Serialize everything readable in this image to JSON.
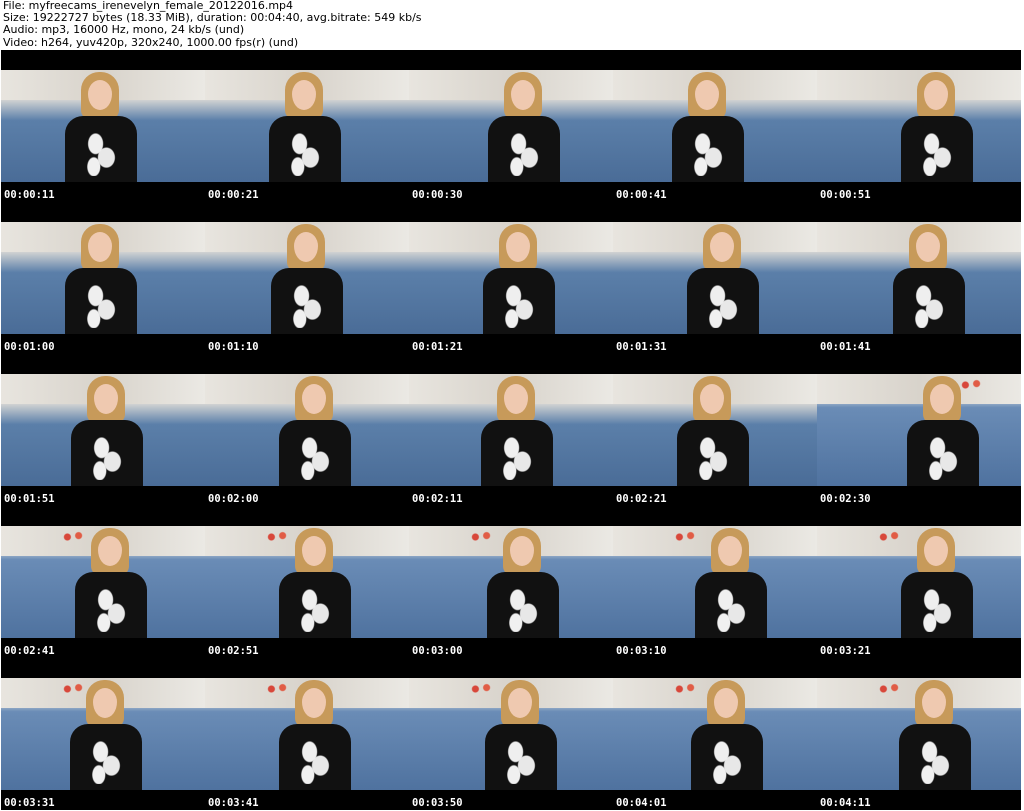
{
  "header": {
    "file": "File: myfreecams_irenevelyn_female_20122016.mp4",
    "size": "Size: 19222727 bytes (18.33 MiB), duration: 00:04:40, avg.bitrate: 549 kb/s",
    "audio": "Audio: mp3, 16000 Hz, mono, 24 kb/s (und)",
    "video": "Video: h264, yuv420p, 320x240, 1000.00 fps(r) (und)"
  },
  "thumbnails": [
    "00:00:11",
    "00:00:21",
    "00:00:30",
    "00:00:41",
    "00:00:51",
    "00:01:00",
    "00:01:10",
    "00:01:21",
    "00:01:31",
    "00:01:41",
    "00:01:51",
    "00:02:00",
    "00:02:11",
    "00:02:21",
    "00:02:30",
    "00:02:41",
    "00:02:51",
    "00:03:00",
    "00:03:10",
    "00:03:21",
    "00:03:31",
    "00:03:41",
    "00:03:50",
    "00:04:01",
    "00:04:11"
  ]
}
